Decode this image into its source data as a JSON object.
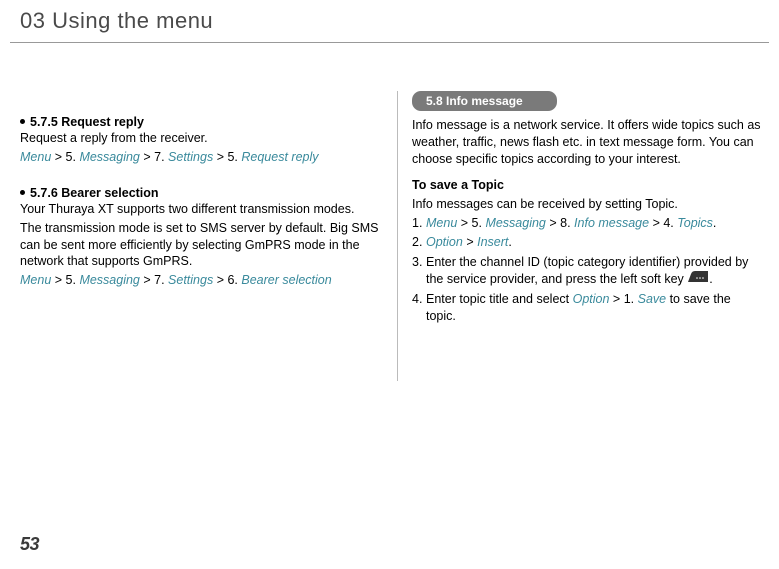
{
  "chapter_title": "03 Using the menu",
  "page_number": "53",
  "left": {
    "s575": {
      "heading": "5.7.5  Request reply",
      "text": "Request a reply from the receiver.",
      "path": {
        "p1": "Menu",
        "s1": " > 5. ",
        "p2": "Messaging",
        "s2": " > 7. ",
        "p3": "Settings",
        "s3": " > 5. ",
        "p4": "Request reply"
      }
    },
    "s576": {
      "heading": "5.7.6  Bearer selection",
      "text1": "Your Thuraya XT supports two different transmission modes.",
      "text2": "The transmission mode is set to SMS server by default. Big SMS can be sent more efficiently by selecting GmPRS mode in the network that supports GmPRS.",
      "path": {
        "p1": "Menu",
        "s1": " > 5. ",
        "p2": "Messaging",
        "s2": " > 7. ",
        "p3": "Settings",
        "s3": " > 6. ",
        "p4": "Bearer selection"
      }
    }
  },
  "right": {
    "pill": "5.8  Info message",
    "intro": "Info message is a network service. It offers wide topics such as weather, traffic, news flash etc. in text message form. You can choose specific topics according to your interest.",
    "save_heading": "To save a Topic",
    "save_intro": "Info messages can be received by setting Topic.",
    "step1": {
      "n": "1.",
      "p1": "Menu",
      "s1": " > 5. ",
      "p2": "Messaging",
      "s2": " > 8. ",
      "p3": "Info message",
      "s3": " > 4. ",
      "p4": "Topics",
      "tail": "."
    },
    "step2": {
      "n": "2.",
      "p1": "Option",
      "s1": " > ",
      "p2": "Insert",
      "tail": "."
    },
    "step3": {
      "n": "3.",
      "text_a": "Enter the channel ID (topic category identifier) provided by the service provider, and press the left soft key ",
      "text_b": "."
    },
    "step4": {
      "n": "4.",
      "text_a": "Enter topic title and select ",
      "p1": "Option",
      "s1": " > 1. ",
      "p2": "Save",
      "text_b": " to save the topic."
    }
  }
}
